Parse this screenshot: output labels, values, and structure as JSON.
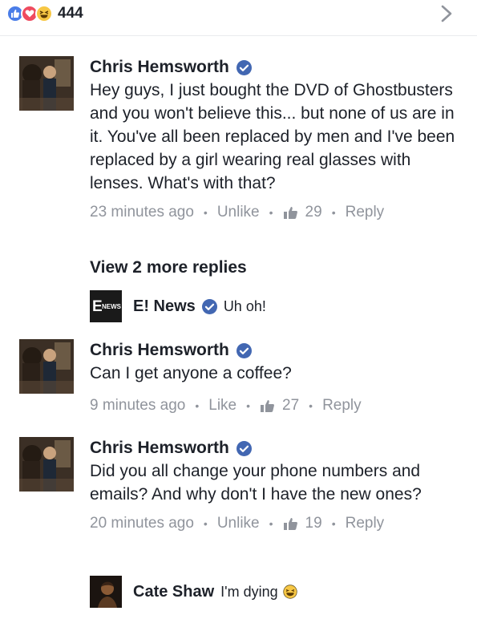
{
  "reactions": {
    "icons": [
      "like-icon",
      "love-icon",
      "haha-icon"
    ],
    "count": "444"
  },
  "view_more": "View 2 more replies",
  "comments": [
    {
      "author": "Chris Hemsworth",
      "text": "Hey guys, I just bought the DVD of Ghostbusters and you won't believe this... but none of us are in it. You've all been replaced by men and I've been replaced by a girl wearing real glasses with lenses. What's with that?",
      "time": "23 minutes ago",
      "action": "Unlike",
      "likes": "29",
      "reply": "Reply"
    },
    {
      "author": "Chris Hemsworth",
      "text": "Can I get anyone a coffee?",
      "time": "9 minutes ago",
      "action": "Like",
      "likes": "27",
      "reply": "Reply"
    },
    {
      "author": "Chris Hemsworth",
      "text": "Did you all change your phone numbers and emails? And why don't I have the new ones?",
      "time": "20 minutes ago",
      "action": "Unlike",
      "likes": "19",
      "reply": "Reply"
    }
  ],
  "replies": [
    {
      "author": "E! News",
      "text": "Uh oh!",
      "avatar_text": "E NEWS"
    },
    {
      "author": "Cate Shaw",
      "text": "I'm dying"
    }
  ],
  "colors": {
    "accent": "#4267b2",
    "meta": "#90949c",
    "text": "#1d2129"
  }
}
